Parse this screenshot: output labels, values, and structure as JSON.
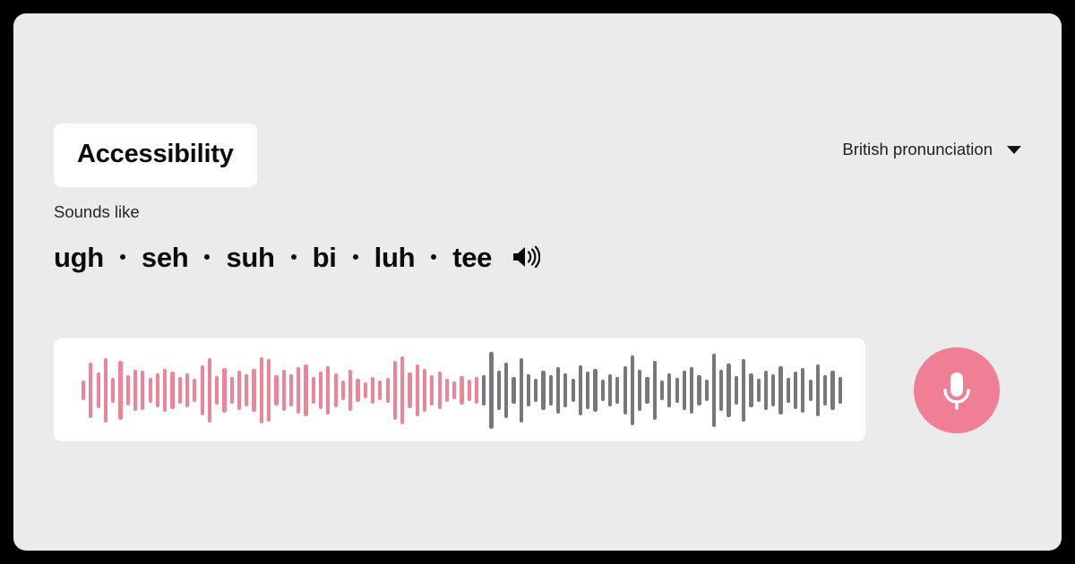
{
  "page": {
    "background_color": "#000000",
    "card_color": "#ebebeb"
  },
  "header": {
    "title": "Accessibility",
    "title_chip_bg": "#ffffff",
    "pronunciation_select": {
      "value": "British pronunciation",
      "caret_icon": "chevron-down-icon"
    }
  },
  "sounds_like": {
    "label": "Sounds like",
    "syllables": [
      "ugh",
      "seh",
      "suh",
      "bi",
      "luh",
      "tee"
    ],
    "separator": "·",
    "play_icon": "speaker-volume-icon"
  },
  "waveform": {
    "panel_bg": "#ffffff",
    "played_color": "#ef8398",
    "remaining_color": "#77777d",
    "played_bar_count": 54,
    "total_bar_count": 103,
    "heights": [
      22,
      62,
      40,
      72,
      28,
      66,
      34,
      46,
      44,
      28,
      38,
      48,
      42,
      30,
      38,
      26,
      56,
      72,
      32,
      50,
      30,
      44,
      36,
      48,
      74,
      70,
      34,
      46,
      36,
      52,
      58,
      30,
      42,
      54,
      38,
      22,
      46,
      26,
      18,
      30,
      22,
      28,
      66,
      76,
      40,
      58,
      48,
      34,
      42,
      26,
      20,
      32,
      24,
      30,
      34,
      86,
      44,
      62,
      30,
      72,
      36,
      26,
      44,
      34,
      52,
      38,
      26,
      56,
      42,
      48,
      24,
      36,
      30,
      54,
      78,
      46,
      30,
      66,
      22,
      38,
      28,
      44,
      52,
      34,
      24,
      82,
      46,
      60,
      32,
      70,
      38,
      26,
      44,
      36,
      54,
      28,
      42,
      50,
      24,
      58,
      34,
      44,
      30
    ]
  },
  "mic_button": {
    "color": "#f07f96",
    "icon": "microphone-icon",
    "label": "Record"
  }
}
